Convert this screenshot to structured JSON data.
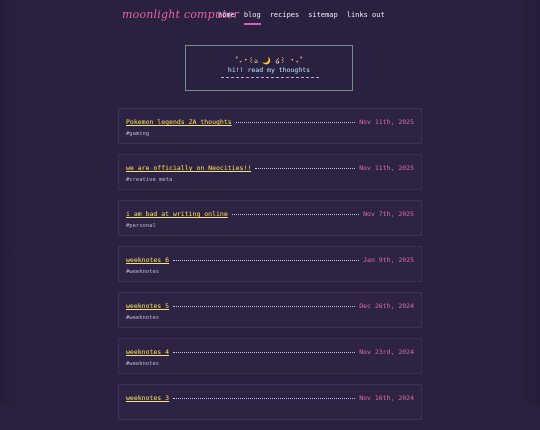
{
  "site": {
    "name": "moonlight computer"
  },
  "nav": {
    "items": [
      {
        "label": "home"
      },
      {
        "label": "blog"
      },
      {
        "label": "recipes"
      },
      {
        "label": "sitemap"
      },
      {
        "label": "links out"
      }
    ],
    "active_index": 1
  },
  "intro": {
    "decoration_left": "˚₊‧꒰ა",
    "decoration_moon": "🌙",
    "decoration_right": "໒꒱ ‧₊˚",
    "tagline": "hi!! read my thoughts"
  },
  "posts": [
    {
      "title": "Pokemon legends ZA thoughts",
      "date": "Nov 11th, 2025",
      "tag": "#gaming"
    },
    {
      "title": "we are officially on Neocities!!",
      "date": "Nov 11th, 2025",
      "tag": "#creative meta"
    },
    {
      "title": "i am bad at writing online",
      "date": "Nov 7th, 2025",
      "tag": "#personal"
    },
    {
      "title": "weeknotes 6",
      "date": "Jan 9th, 2025",
      "tag": "#weeknotes"
    },
    {
      "title": "weeknotes 5",
      "date": "Dec 26th, 2024",
      "tag": "#weeknotes"
    },
    {
      "title": "weeknotes 4",
      "date": "Nov 23rd, 2024",
      "tag": "#weeknotes"
    },
    {
      "title": "weeknotes 3",
      "date": "Nov 16th, 2024",
      "tag": ""
    }
  ],
  "colors": {
    "background": "#2a2140",
    "logo": "#e8639d",
    "title": "#ffe36a",
    "date": "#e06aa7",
    "active_underline": "#d65fb3"
  }
}
